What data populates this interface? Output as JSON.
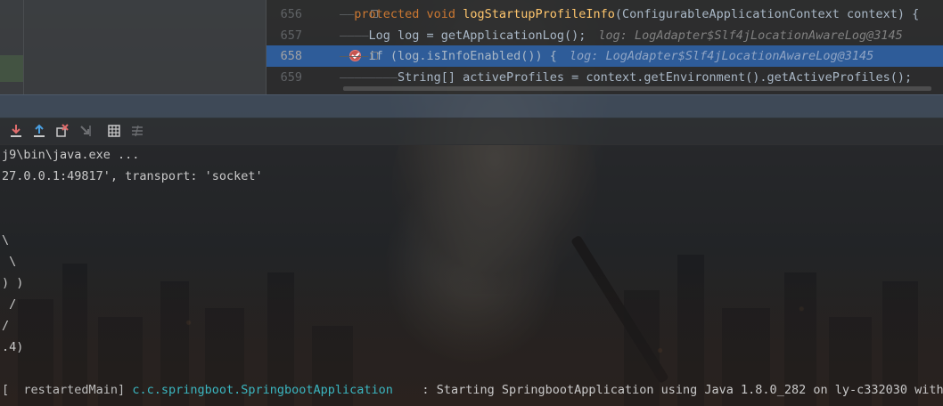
{
  "editor": {
    "lines": [
      {
        "num": "656",
        "guide": "——",
        "kw": "protected void ",
        "fn": "logStartupProfileInfo",
        "rest": "(ConfigurableApplicationContext context) {",
        "hint": ""
      },
      {
        "num": "657",
        "guide": "————",
        "kw": "",
        "fn": "",
        "rest": "Log log = getApplicationLog();",
        "hint": "log: LogAdapter$Slf4jLocationAwareLog@3145"
      },
      {
        "num": "658",
        "guide": "————",
        "kw": "",
        "fn": "",
        "rest": "if (log.isInfoEnabled()) {",
        "hint": "log: LogAdapter$Slf4jLocationAwareLog@3145"
      },
      {
        "num": "659",
        "guide": "————————",
        "kw": "",
        "fn": "",
        "rest": "String[] activeProfiles = context.getEnvironment().getActiveProfiles();",
        "hint": ""
      }
    ],
    "highlighted_line": "658",
    "breakpoint_line": "658"
  },
  "toolbar": {
    "buttons": [
      {
        "icon": "step-into-arrow-icon",
        "color": "#e06c6c"
      },
      {
        "icon": "step-out-arrow-icon",
        "color": "#4a9fe0"
      },
      {
        "icon": "drop-frame-icon",
        "color": "#e06c6c"
      },
      {
        "icon": "run-to-cursor-icon",
        "color": "#6d6f72"
      },
      {
        "icon": "evaluate-table-icon",
        "color": "#c9c9c9"
      },
      {
        "icon": "trace-icon",
        "color": "#6d6f72"
      }
    ]
  },
  "console": {
    "lines": [
      "j9\\bin\\java.exe ...",
      "27.0.0.1:49817', transport: 'socket'",
      "",
      "",
      "\\",
      " \\",
      ") )",
      " /",
      "/",
      ".4)",
      ""
    ],
    "log_prefix": "[  restartedMain] ",
    "log_class": "c.c.springboot.SpringbootApplication",
    "log_message": "    : Starting SpringbootApplication using Java 1.8.0_282 on ly-c332030 with"
  }
}
